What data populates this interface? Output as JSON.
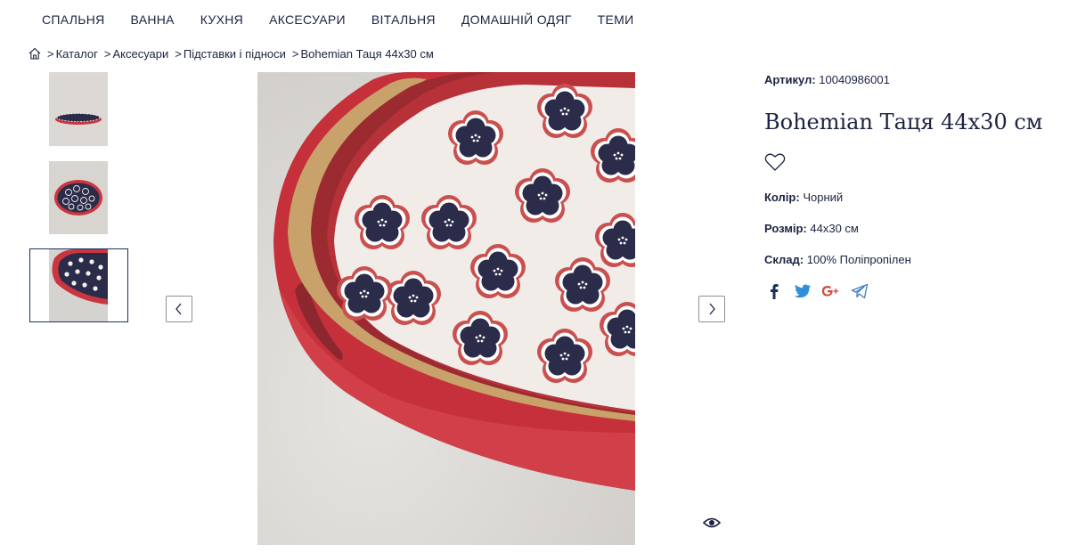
{
  "nav": {
    "items": [
      "СПАЛЬНЯ",
      "ВАННА",
      "КУХНЯ",
      "АКСЕСУАРИ",
      "ВІТАЛЬНЯ",
      "ДОМАШНІЙ ОДЯГ",
      "ТЕМИ"
    ]
  },
  "breadcrumb": {
    "separator": ">",
    "items": [
      "Каталог",
      "Аксесуари",
      "Підставки і підноси",
      "Bohemian Таця 44х30 см"
    ]
  },
  "gallery": {
    "selected_thumbnail": 3,
    "thumbnail_count": 3
  },
  "product": {
    "sku_label": "Артикул:",
    "sku_value": "10040986001",
    "title": "Bohemian Таця 44х30 см",
    "attributes": [
      {
        "label": "Колір:",
        "value": "Чорний"
      },
      {
        "label": "Розмір:",
        "value": "44х30 см"
      },
      {
        "label": "Склад:",
        "value": "100% Поліпропілен"
      }
    ]
  },
  "share": {
    "icons": [
      "facebook-icon",
      "twitter-icon",
      "google-plus-icon",
      "telegram-icon"
    ]
  },
  "colors": {
    "text": "#1b2340",
    "tray_red": "#c9363f",
    "pattern_navy": "#2b2c4a",
    "social_blue": "#2f6db5"
  }
}
